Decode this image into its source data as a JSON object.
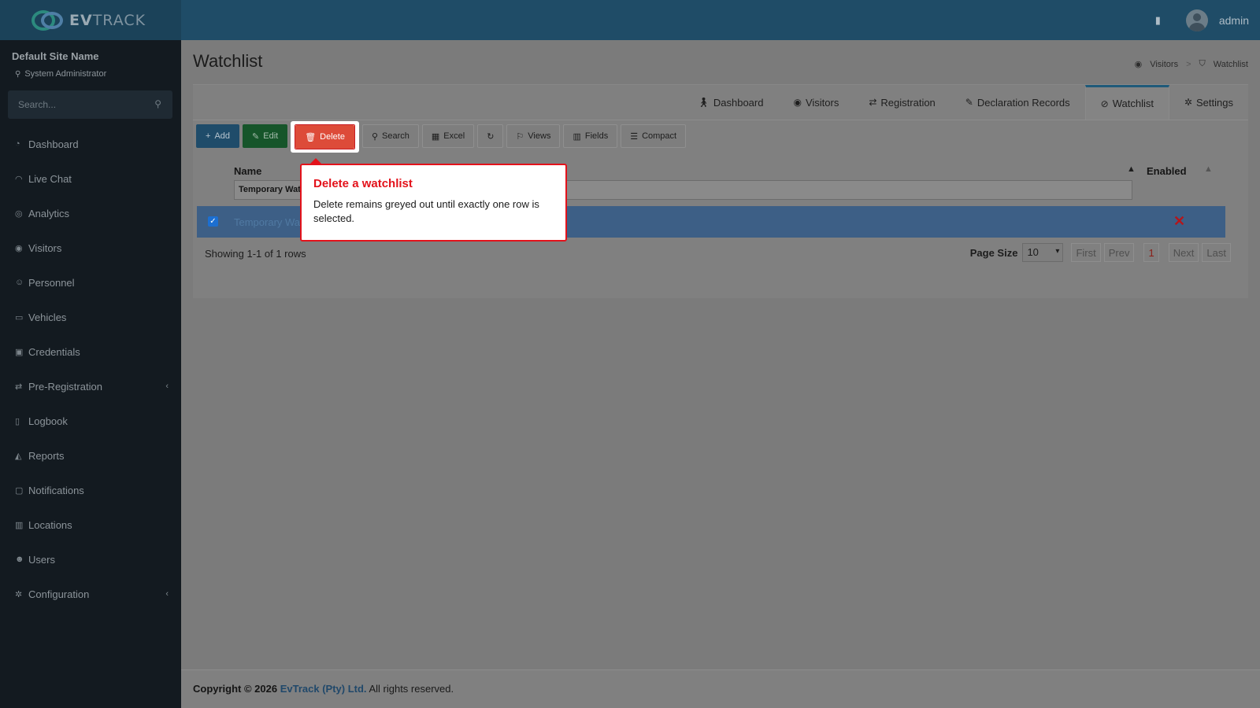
{
  "brand": {
    "name_bold": "EV",
    "name_rest": "TRACK"
  },
  "header": {
    "user": "admin",
    "icon": "building-icon"
  },
  "sidebar": {
    "site_name": "Default Site Name",
    "role": "System Administrator",
    "search_placeholder": "Search...",
    "items": [
      {
        "label": "Dashboard",
        "icon": "dashboard-icon"
      },
      {
        "label": "Live Chat",
        "icon": "headset-icon"
      },
      {
        "label": "Analytics",
        "icon": "target-icon"
      },
      {
        "label": "Visitors",
        "icon": "eye-icon"
      },
      {
        "label": "Personnel",
        "icon": "personnel-icon"
      },
      {
        "label": "Vehicles",
        "icon": "car-icon"
      },
      {
        "label": "Credentials",
        "icon": "id-card-icon"
      },
      {
        "label": "Pre-Registration",
        "icon": "arrows-icon",
        "has_children": true
      },
      {
        "label": "Logbook",
        "icon": "book-icon"
      },
      {
        "label": "Reports",
        "icon": "chart-icon"
      },
      {
        "label": "Notifications",
        "icon": "chat-icon"
      },
      {
        "label": "Locations",
        "icon": "map-icon"
      },
      {
        "label": "Users",
        "icon": "users-icon"
      },
      {
        "label": "Configuration",
        "icon": "gear-icon",
        "has_children": true
      }
    ]
  },
  "page": {
    "title": "Watchlist",
    "breadcrumb": [
      "Visitors",
      "Watchlist"
    ]
  },
  "tabs": [
    {
      "label": "Dashboard",
      "icon": "walk-icon"
    },
    {
      "label": "Visitors",
      "icon": "eye-icon"
    },
    {
      "label": "Registration",
      "icon": "arrows-icon"
    },
    {
      "label": "Declaration Records",
      "icon": "edit-icon"
    },
    {
      "label": "Watchlist",
      "icon": "watchlist-icon",
      "active": true
    },
    {
      "label": "Settings",
      "icon": "gear-icon"
    }
  ],
  "toolbar": {
    "add": "Add",
    "edit": "Edit",
    "delete": "Delete",
    "search": "Search",
    "excel": "Excel",
    "views": "Views",
    "fields": "Fields",
    "compact": "Compact"
  },
  "grid": {
    "columns": [
      "Name",
      "Enabled"
    ],
    "filter_value": "Temporary Watchlist",
    "rows": [
      {
        "name": "Temporary Watchlist",
        "enabled": false,
        "selected": true
      }
    ],
    "showing": "Showing 1-1 of 1 rows"
  },
  "pager": {
    "page_size_label": "Page Size",
    "page_size": "10",
    "first": "First",
    "prev": "Prev",
    "current": "1",
    "next": "Next",
    "last": "Last"
  },
  "tooltip": {
    "title": "Delete a watchlist",
    "body": "Delete remains greyed out until exactly one row is selected."
  },
  "footer": {
    "copyright": "Copyright © 2026",
    "company": "EvTrack (Pty) Ltd.",
    "rights": "All rights reserved."
  },
  "colors": {
    "header": "#1f4c67",
    "sidebar": "#131a20",
    "delete": "#dd4b39",
    "tooltip_accent": "#e3121b"
  }
}
